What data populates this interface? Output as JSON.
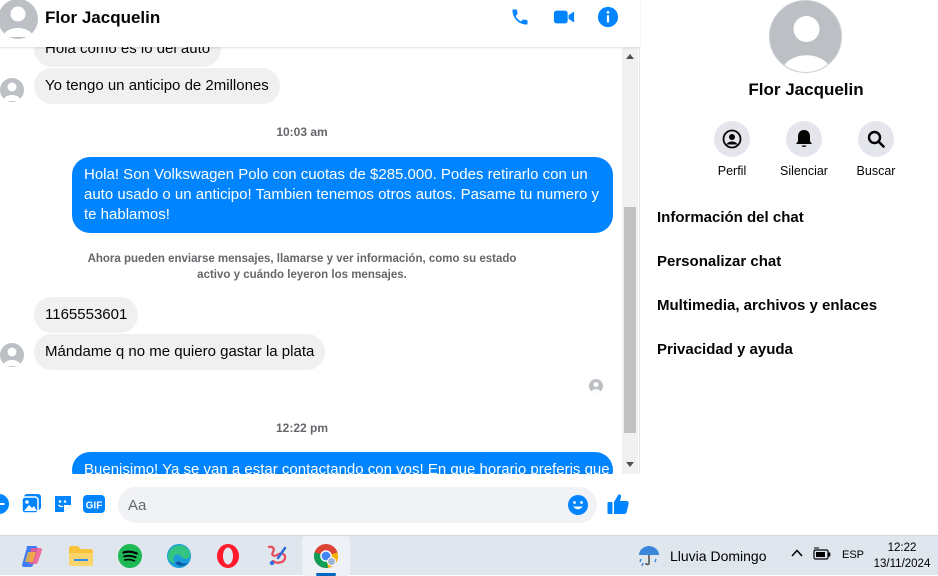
{
  "contact": {
    "name": "Flor Jacquelin"
  },
  "header": {
    "icons": [
      "phone-icon",
      "video-icon",
      "info-icon"
    ],
    "accent": "#0084ff"
  },
  "messages": {
    "partial_top": "Hola como es lo del auto",
    "in1": "Yo tengo un anticipo de 2millones",
    "time1": "10:03 am",
    "out1": "Hola! Son Volkswagen Polo con cuotas de $285.000. Podes retirarlo con un auto usado o un anticipo! Tambien tenemos otros autos. Pasame tu numero y te hablamos!",
    "system_note": "Ahora pueden enviarse mensajes, llamarse y ver información, como su estado activo y cuándo leyeron los mensajes.",
    "in2": "1165553601",
    "in3": "Mándame q no me quiero gastar la plata",
    "time2": "12:22 pm",
    "out2": "Buenisimo! Ya se van a estar contactando con vos! En que horario preferis que"
  },
  "composer": {
    "placeholder": "Aa",
    "icons": [
      "plus-circle-icon",
      "image-icon",
      "sticker-icon",
      "gif-icon",
      "emoji-icon",
      "like-icon"
    ]
  },
  "info_panel": {
    "actions": [
      {
        "label": "Perfil",
        "icon": "profile-icon"
      },
      {
        "label": "Silenciar",
        "icon": "bell-icon"
      },
      {
        "label": "Buscar",
        "icon": "search-icon"
      }
    ],
    "menu": [
      "Información del chat",
      "Personalizar chat",
      "Multimedia, archivos y enlaces",
      "Privacidad y ayuda"
    ]
  },
  "taskbar": {
    "apps": [
      "copilot-icon",
      "file-explorer-icon",
      "spotify-icon",
      "edge-icon",
      "opera-icon",
      "paint-icon",
      "chrome-icon"
    ],
    "weather": "Lluvia Domingo",
    "language": "ESP",
    "time": "12:22",
    "date": "13/11/2024"
  }
}
